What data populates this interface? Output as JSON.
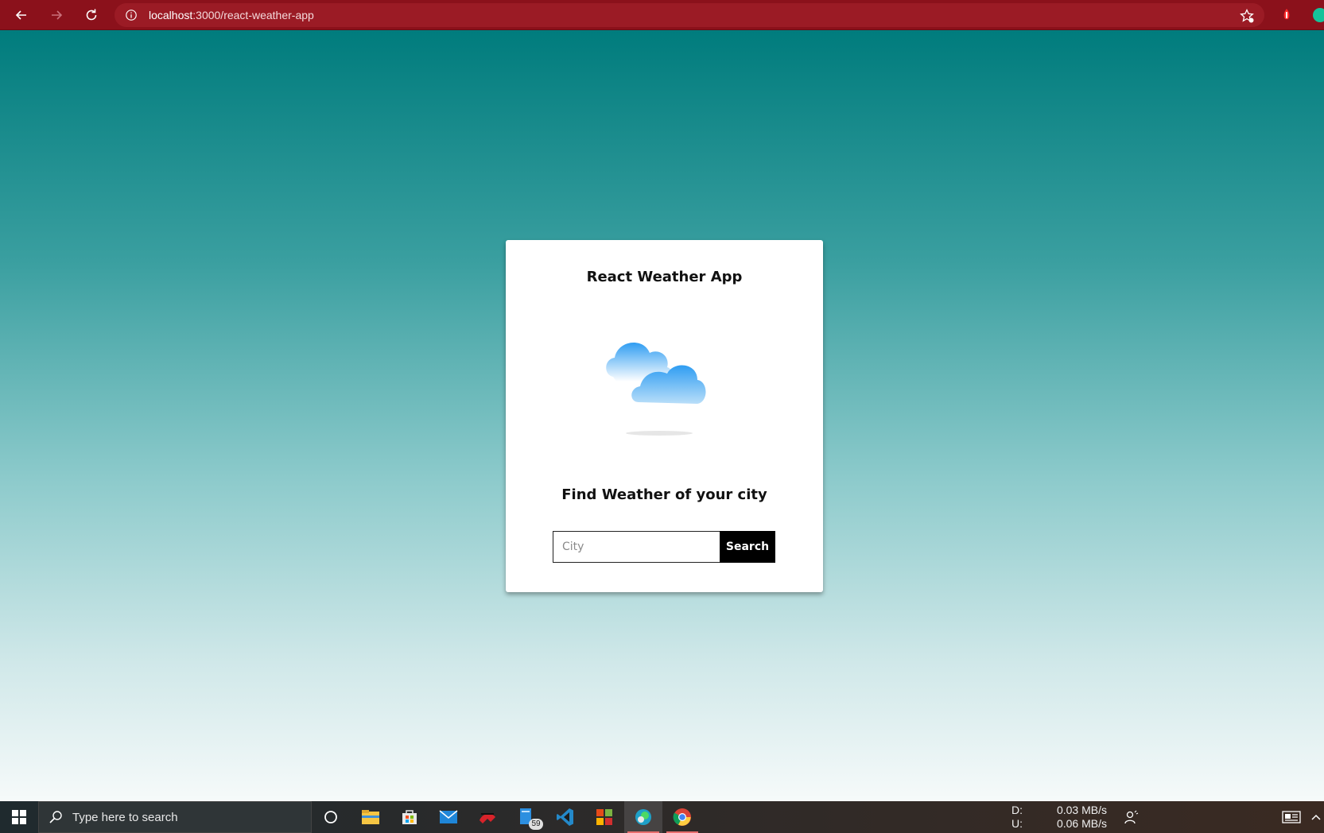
{
  "browser": {
    "url_host": "localhost",
    "url_path": ":3000/react-weather-app",
    "accent_color": "#8b111b"
  },
  "app": {
    "title": "React Weather App",
    "subtitle": "Find Weather of your city",
    "search": {
      "placeholder": "City",
      "value": "",
      "button_label": "Search"
    }
  },
  "taskbar": {
    "search_placeholder": "Type here to search",
    "pinned_apps": [
      "file-explorer-icon",
      "store-icon",
      "mail-icon",
      "app-icon",
      "notes-icon",
      "vscode-icon",
      "office-icon",
      "edge-icon",
      "chrome-icon"
    ],
    "notes_badge": "59",
    "network": {
      "down_label": "D:",
      "down_value": "0.03 MB/s",
      "up_label": "U:",
      "up_value": "0.06 MB/s"
    }
  }
}
